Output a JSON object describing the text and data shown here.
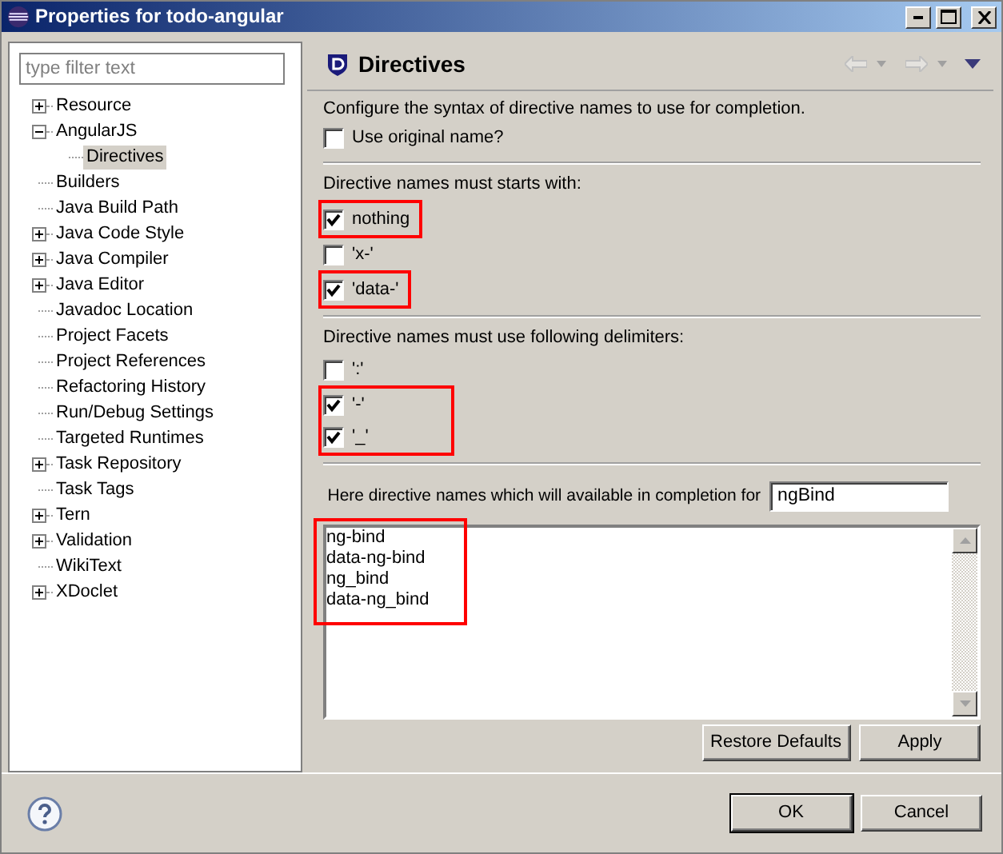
{
  "window": {
    "title": "Properties for todo-angular"
  },
  "filter": {
    "placeholder": "type filter text"
  },
  "tree": [
    {
      "label": "Resource",
      "selected": false,
      "expanded": false
    },
    {
      "label": "AngularJS",
      "selected": false,
      "expanded": true,
      "children": [
        {
          "label": "Directives",
          "selected": true
        }
      ]
    },
    {
      "label": "Builders",
      "selected": false
    },
    {
      "label": "Java Build Path",
      "selected": false
    },
    {
      "label": "Java Code Style",
      "selected": false,
      "expanded": false
    },
    {
      "label": "Java Compiler",
      "selected": false,
      "expanded": false
    },
    {
      "label": "Java Editor",
      "selected": false,
      "expanded": false
    },
    {
      "label": "Javadoc Location",
      "selected": false
    },
    {
      "label": "Project Facets",
      "selected": false
    },
    {
      "label": "Project References",
      "selected": false
    },
    {
      "label": "Refactoring History",
      "selected": false
    },
    {
      "label": "Run/Debug Settings",
      "selected": false
    },
    {
      "label": "Targeted Runtimes",
      "selected": false
    },
    {
      "label": "Task Repository",
      "selected": false,
      "expanded": false
    },
    {
      "label": "Task Tags",
      "selected": false
    },
    {
      "label": "Tern",
      "selected": false,
      "expanded": false
    },
    {
      "label": "Validation",
      "selected": false,
      "expanded": false
    },
    {
      "label": "WikiText",
      "selected": false
    },
    {
      "label": "XDoclet",
      "selected": false,
      "expanded": false
    }
  ],
  "page": {
    "title": "Directives",
    "description": "Configure the syntax of directive names to use for completion.",
    "use_original": {
      "label": "Use original name?",
      "checked": false
    },
    "sections": [
      {
        "heading": "Directive names must starts with:",
        "options": [
          {
            "label": "nothing",
            "checked": true,
            "highlighted": true
          },
          {
            "label": "'x-'",
            "checked": false,
            "highlighted": false
          },
          {
            "label": "'data-'",
            "checked": true,
            "highlighted": true
          }
        ]
      },
      {
        "heading": "Directive names must use following delimiters:",
        "options": [
          {
            "label": "':'",
            "checked": false,
            "highlighted": false
          },
          {
            "label": "'-'",
            "checked": true,
            "highlighted": true
          },
          {
            "label": "'_'",
            "checked": true,
            "highlighted": true
          }
        ]
      }
    ],
    "completion": {
      "label": "Here directive names which will available in completion for",
      "value": "ngBind"
    },
    "results": {
      "highlighted": true,
      "lines": [
        "ng-bind",
        "data-ng-bind",
        "ng_bind",
        "data-ng_bind"
      ]
    },
    "buttons": [
      "Restore Defaults",
      "Apply"
    ]
  },
  "footer": {
    "buttons": [
      "OK",
      "Cancel"
    ]
  }
}
